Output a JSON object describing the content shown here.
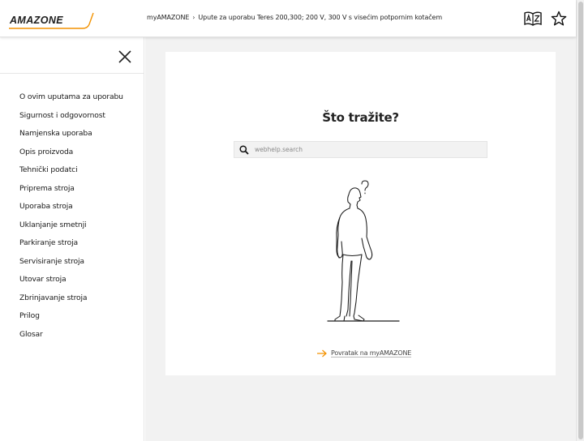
{
  "brand": {
    "logo_text": "AMAZONE",
    "accent": "#f39200"
  },
  "header": {
    "breadcrumb": [
      "myAMAZONE",
      "Upute za uporabu Teres 200,300; 200 V, 300 V s visećim potpornim kotačem"
    ],
    "icons": [
      "translate-icon",
      "star-icon"
    ]
  },
  "sidebar": {
    "items": [
      "O ovim uputama za uporabu",
      "Sigurnost i odgovornost",
      "Namjenska uporaba",
      "Opis proizvoda",
      "Tehnički podatci",
      "Priprema stroja",
      "Uporaba stroja",
      "Uklanjanje smetnji",
      "Parkiranje stroja",
      "Servisiranje stroja",
      "Utovar stroja",
      "Zbrinjavanje stroja",
      "Prilog",
      "Glosar"
    ]
  },
  "main": {
    "title": "Što tražite?",
    "search": {
      "placeholder": "webhelp.search",
      "value": ""
    },
    "back_link": "Povratak na myAMAZONE"
  }
}
